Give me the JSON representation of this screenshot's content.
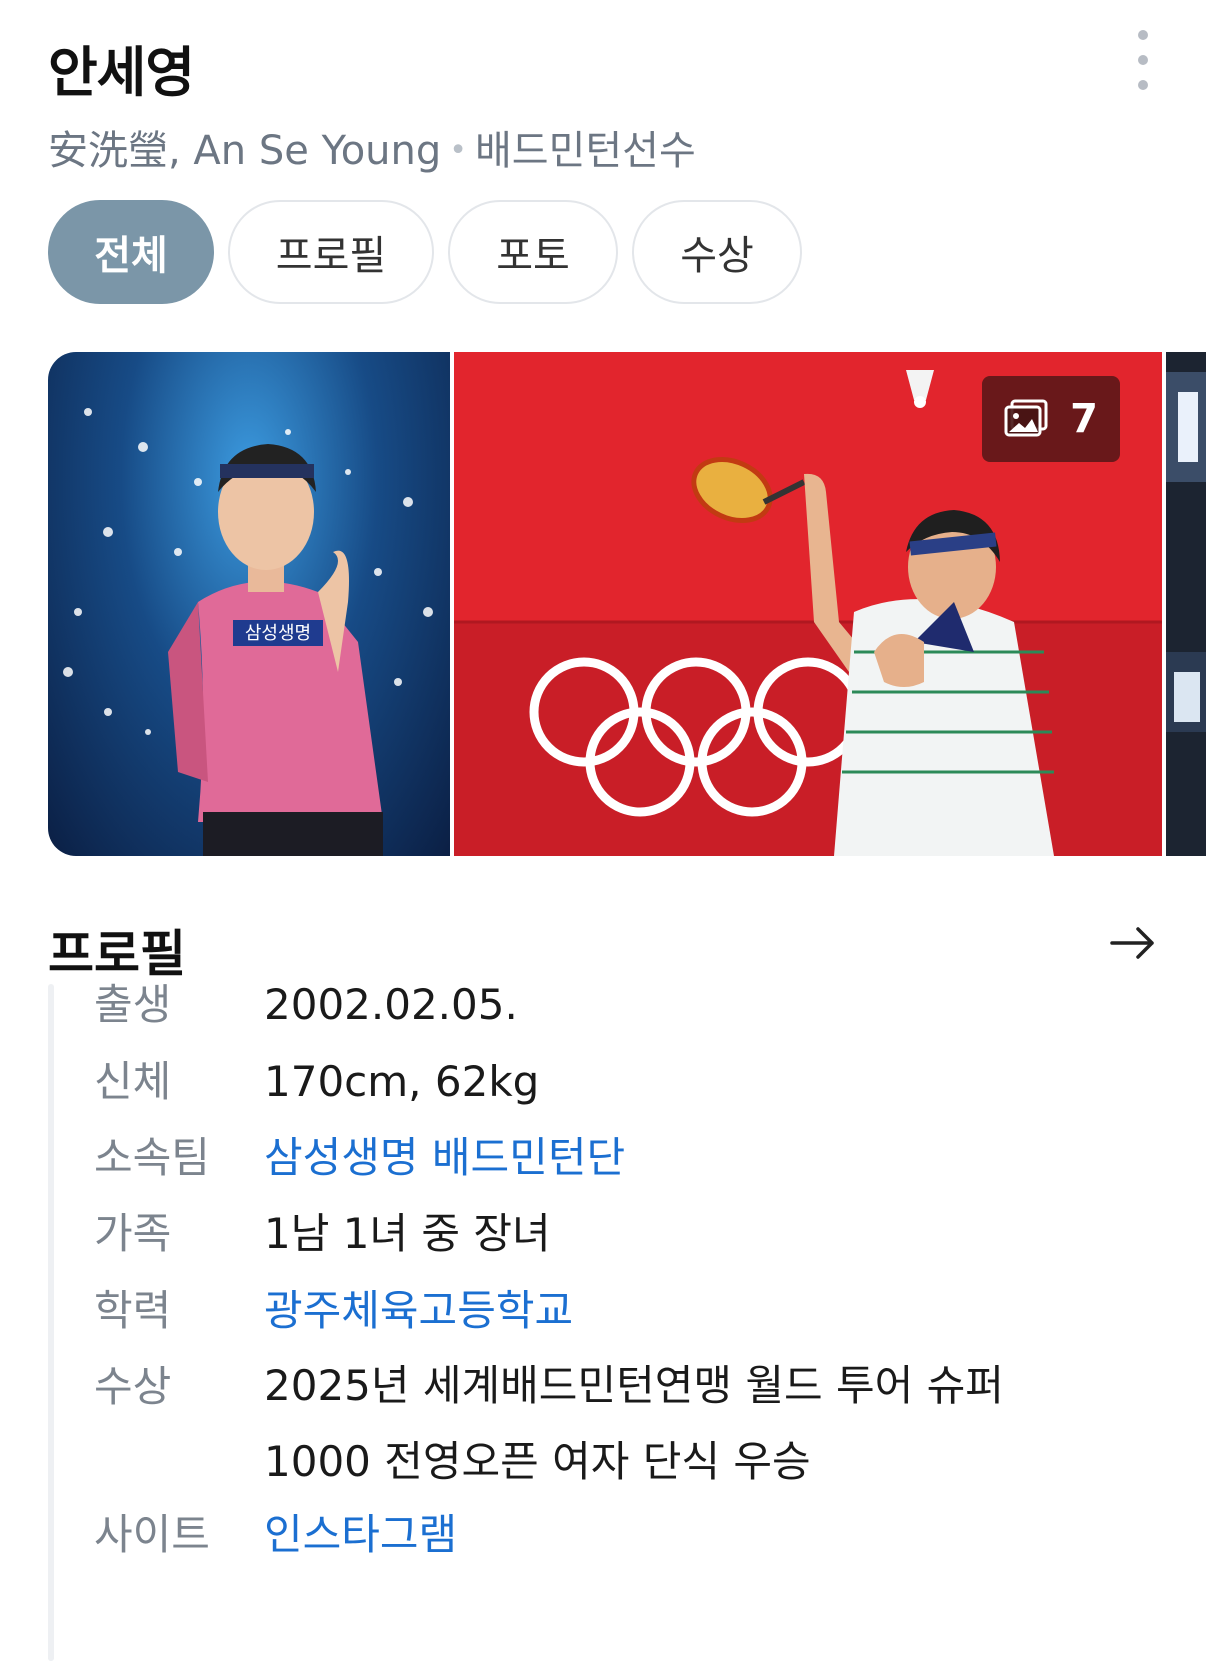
{
  "header": {
    "name": "안세영",
    "aliases": "安洗瑩, An Se Young",
    "occupation": "배드민턴선수"
  },
  "tabs": [
    {
      "label": "전체",
      "active": true
    },
    {
      "label": "프로필",
      "active": false
    },
    {
      "label": "포토",
      "active": false
    },
    {
      "label": "수상",
      "active": false
    }
  ],
  "photos": {
    "count": "7",
    "icon": "image-gallery-icon",
    "photo1_jersey_text": "삼성생명"
  },
  "profile": {
    "title": "프로필",
    "rows": [
      {
        "key": "출생",
        "value": "2002.02.05.",
        "link": false
      },
      {
        "key": "신체",
        "value": "170cm, 62kg",
        "link": false
      },
      {
        "key": "소속팀",
        "value": "삼성생명 배드민턴단",
        "link": true
      },
      {
        "key": "가족",
        "value": "1남 1녀 중 장녀",
        "link": false
      },
      {
        "key": "학력",
        "value": "광주체육고등학교",
        "link": true
      },
      {
        "key": "수상",
        "value_line1": "2025년 세계배드민턴연맹 월드 투어 슈퍼",
        "value_line2": "1000 전영오픈 여자 단식 우승",
        "link": false
      },
      {
        "key": "사이트",
        "value": "인스타그램",
        "link": true
      }
    ]
  },
  "colors": {
    "active_tab": "#7b96a8",
    "link": "#1b6fd1",
    "muted": "#7c848e"
  }
}
